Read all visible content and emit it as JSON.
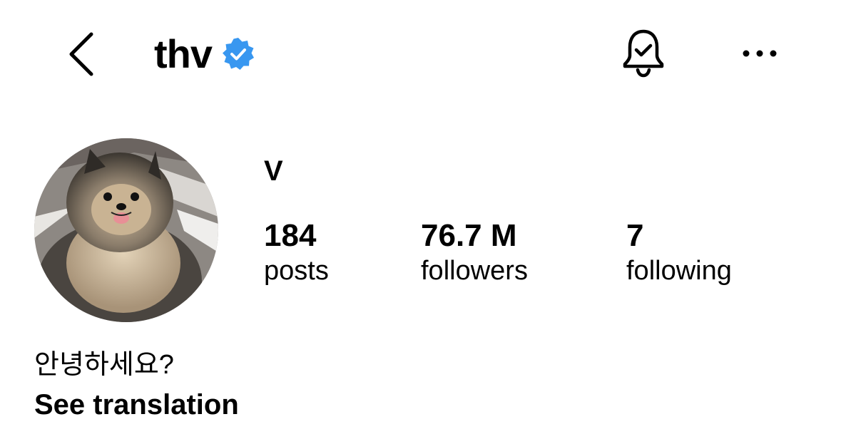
{
  "header": {
    "username": "thv",
    "verified": true,
    "icons": {
      "back": "chevron-left-icon",
      "verified": "verified-badge-icon",
      "notifications": "bell-check-icon",
      "more": "more-horizontal-icon"
    }
  },
  "profile": {
    "display_name": "V",
    "stats": [
      {
        "value": "184",
        "label": "posts"
      },
      {
        "value": "76.7 M",
        "label": "followers"
      },
      {
        "value": "7",
        "label": "following"
      }
    ],
    "bio": "안녕하세요?",
    "translate_label": "See translation"
  },
  "colors": {
    "verified_blue": "#3897f0",
    "text": "#000000",
    "background": "#ffffff"
  }
}
